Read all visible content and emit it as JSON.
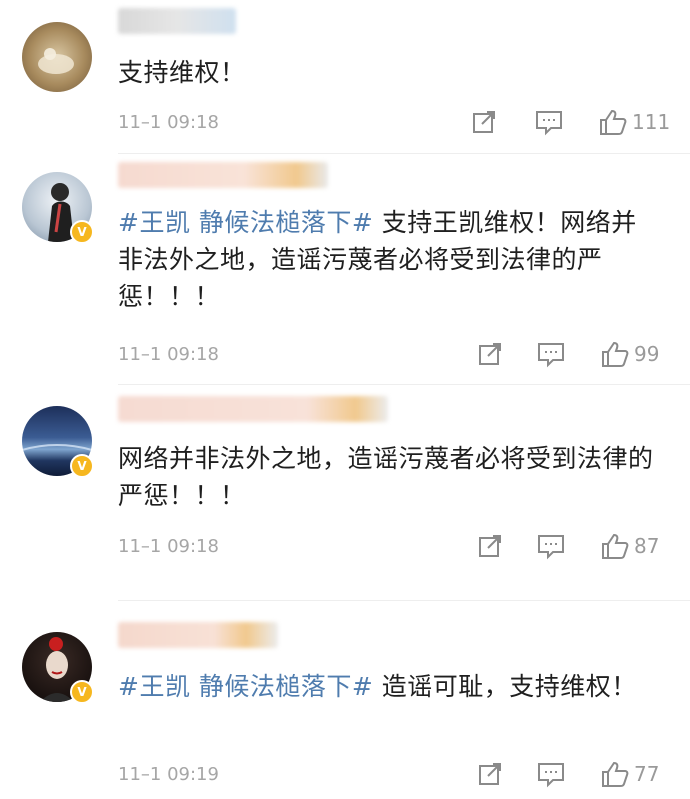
{
  "comments": [
    {
      "tag": "",
      "text": "支持维权！",
      "time": "11–1 09:18",
      "likes": "111"
    },
    {
      "tag": "#王凯 静候法槌落下#",
      "text": " 支持王凯维权！网络并非法外之地，造谣污蔑者必将受到法律的严惩！！！",
      "time": "11–1 09:18",
      "likes": "99"
    },
    {
      "tag": "",
      "text": "网络并非法外之地，造谣污蔑者必将受到法律的严惩！！！",
      "time": "11–1 09:18",
      "likes": "87"
    },
    {
      "tag": "#王凯 静候法槌落下#",
      "text": " 造谣可耻，支持维权！",
      "time": "11–1 09:19",
      "likes": "77"
    }
  ],
  "icons": [
    "share-icon",
    "comment-icon",
    "like-icon"
  ],
  "colors": {
    "tag": "#4f7cae",
    "meta": "#a6a6a6",
    "badge": "#f6b71f"
  }
}
